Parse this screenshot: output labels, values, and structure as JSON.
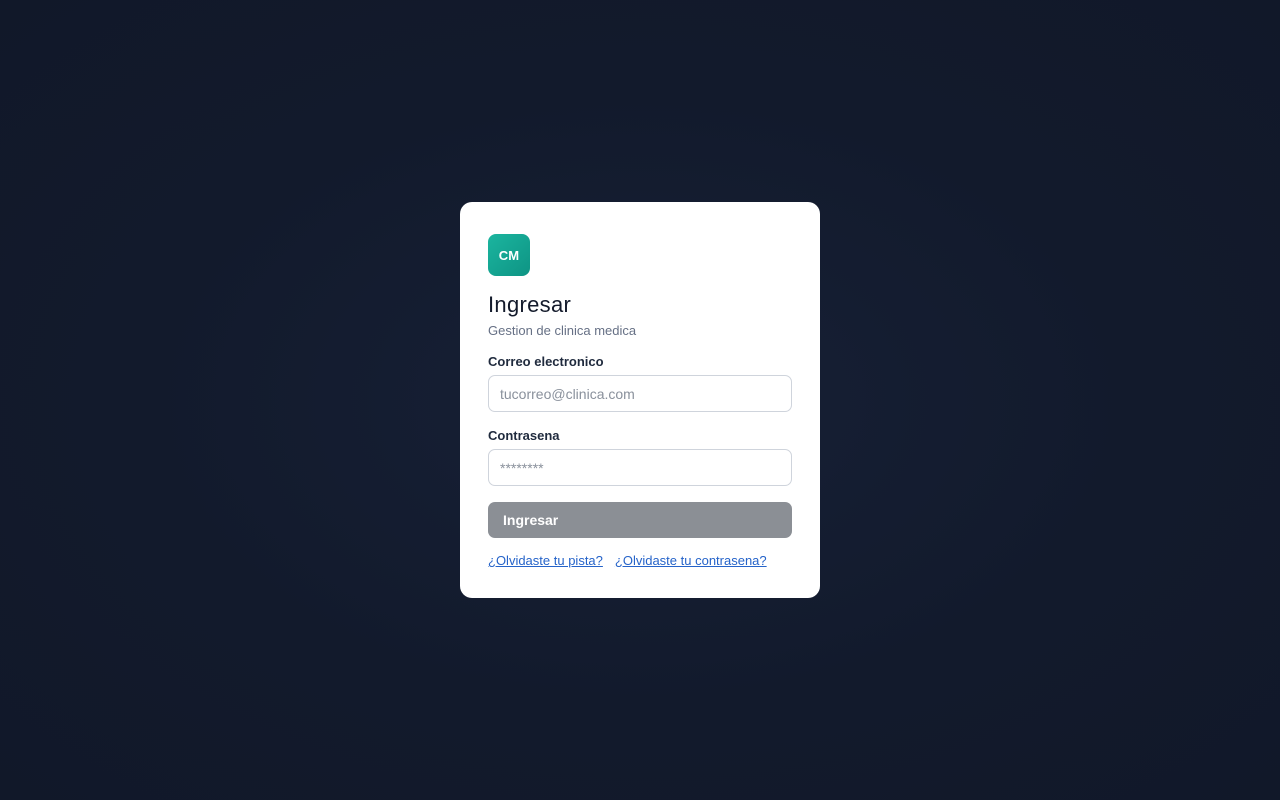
{
  "brand": {
    "logo_text": "CM",
    "logo_color": "#14a693"
  },
  "login": {
    "title": "Ingresar",
    "subtitle": "Gestion de clinica medica",
    "email": {
      "label": "Correo electronico",
      "value": "",
      "placeholder": "tucorreo@clinica.com"
    },
    "password": {
      "label": "Contrasena",
      "value": "",
      "placeholder": "********"
    },
    "submit_label": "Ingresar",
    "submit_color": "#8b8f95",
    "links": {
      "forgot_hint": "¿Olvidaste tu pista?",
      "forgot_password": "¿Olvidaste tu contrasena?"
    }
  },
  "colors": {
    "background": "#131a2b",
    "card": "#ffffff",
    "link": "#2563c9"
  }
}
